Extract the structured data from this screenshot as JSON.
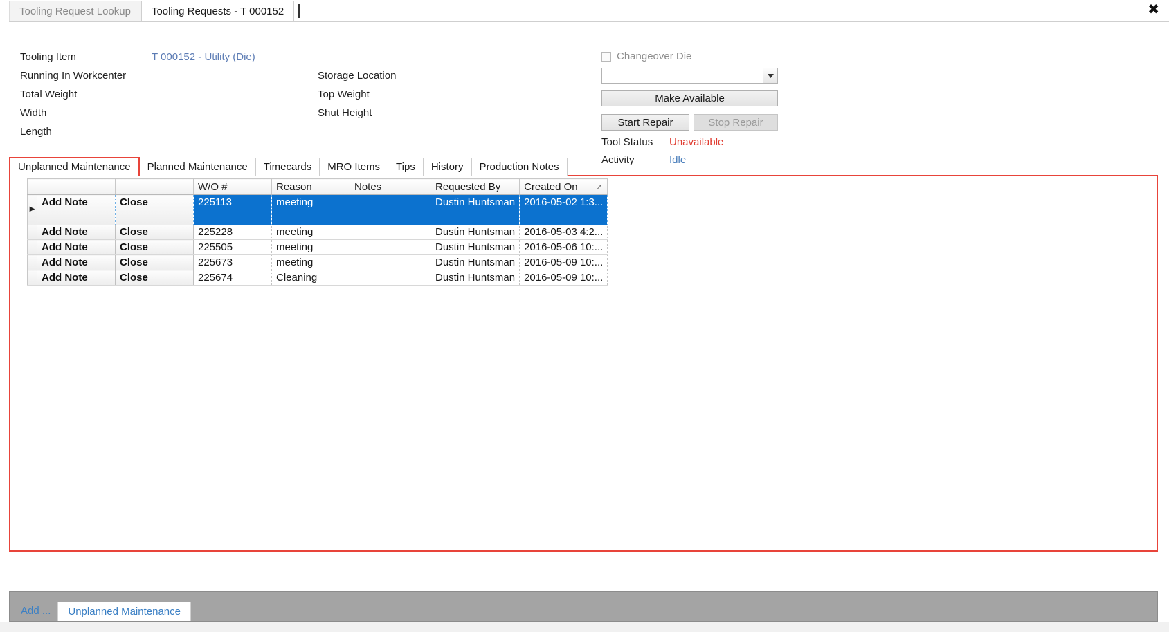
{
  "window": {
    "close_icon": "close-icon",
    "close_glyph": "✖",
    "tabs": [
      {
        "label": "Tooling Request Lookup",
        "active": false
      },
      {
        "label": "Tooling Requests - T 000152",
        "active": true
      }
    ]
  },
  "details": {
    "fields": [
      {
        "label": "Tooling Item",
        "value": "T 000152 - Utility (Die)",
        "value_is_link": true
      },
      {
        "label": "Running In Workcenter",
        "value": ""
      },
      {
        "label": "Total Weight",
        "value": ""
      },
      {
        "label": "Width",
        "value": ""
      },
      {
        "label": "Length",
        "value": ""
      }
    ],
    "fields_right": [
      {
        "label": "Storage Location",
        "value": ""
      },
      {
        "label": "Top Weight",
        "value": ""
      },
      {
        "label": "Shut Height",
        "value": ""
      }
    ]
  },
  "controls": {
    "changeover_die_label": "Changeover Die",
    "changeover_die_checked": false,
    "dropdown_value": "",
    "dropdown_icon": "chevron-down-icon",
    "make_available_label": "Make Available",
    "start_repair_label": "Start Repair",
    "stop_repair_label": "Stop Repair",
    "stop_repair_disabled": true,
    "tool_status_label": "Tool Status",
    "tool_status_value": "Unavailable",
    "tool_status_color": "#e03c31",
    "activity_label": "Activity",
    "activity_value": "Idle",
    "activity_color": "#4a7ebb"
  },
  "inner_tabs": [
    {
      "label": "Unplanned Maintenance",
      "active": true
    },
    {
      "label": "Planned Maintenance",
      "active": false
    },
    {
      "label": "Timecards",
      "active": false
    },
    {
      "label": "MRO Items",
      "active": false
    },
    {
      "label": "Tips",
      "active": false
    },
    {
      "label": "History",
      "active": false
    },
    {
      "label": "Production Notes",
      "active": false
    }
  ],
  "grid": {
    "headers": [
      "",
      "",
      "",
      "W/O #",
      "Reason",
      "Notes",
      "Requested By",
      "Created On"
    ],
    "sort_column": "Created On",
    "sort_glyph": "↗",
    "action_add_note": "Add Note",
    "action_close": "Close",
    "row_indicator_glyph": "▶",
    "rows": [
      {
        "selected": true,
        "add_note": "Add Note",
        "close": "Close",
        "wo": "225113",
        "reason": "meeting",
        "notes": "",
        "requested_by": "Dustin Huntsman",
        "created_on": "2016-05-02  1:3..."
      },
      {
        "selected": false,
        "add_note": "Add Note",
        "close": "Close",
        "wo": "225228",
        "reason": "meeting",
        "notes": "",
        "requested_by": "Dustin Huntsman",
        "created_on": "2016-05-03  4:2..."
      },
      {
        "selected": false,
        "add_note": "Add Note",
        "close": "Close",
        "wo": "225505",
        "reason": "meeting",
        "notes": "",
        "requested_by": "Dustin Huntsman",
        "created_on": "2016-05-06  10:..."
      },
      {
        "selected": false,
        "add_note": "Add Note",
        "close": "Close",
        "wo": "225673",
        "reason": "meeting",
        "notes": "",
        "requested_by": "Dustin Huntsman",
        "created_on": "2016-05-09  10:..."
      },
      {
        "selected": false,
        "add_note": "Add Note",
        "close": "Close",
        "wo": "225674",
        "reason": "Cleaning",
        "notes": "",
        "requested_by": "Dustin Huntsman",
        "created_on": "2016-05-09  10:..."
      }
    ]
  },
  "bottom_dock": {
    "add_label": "Add ...",
    "tab_label": "Unplanned Maintenance"
  },
  "colors": {
    "selection_blue": "#0c72cf",
    "highlight_red": "#e8443a",
    "link_blue": "#5b7bb4"
  }
}
